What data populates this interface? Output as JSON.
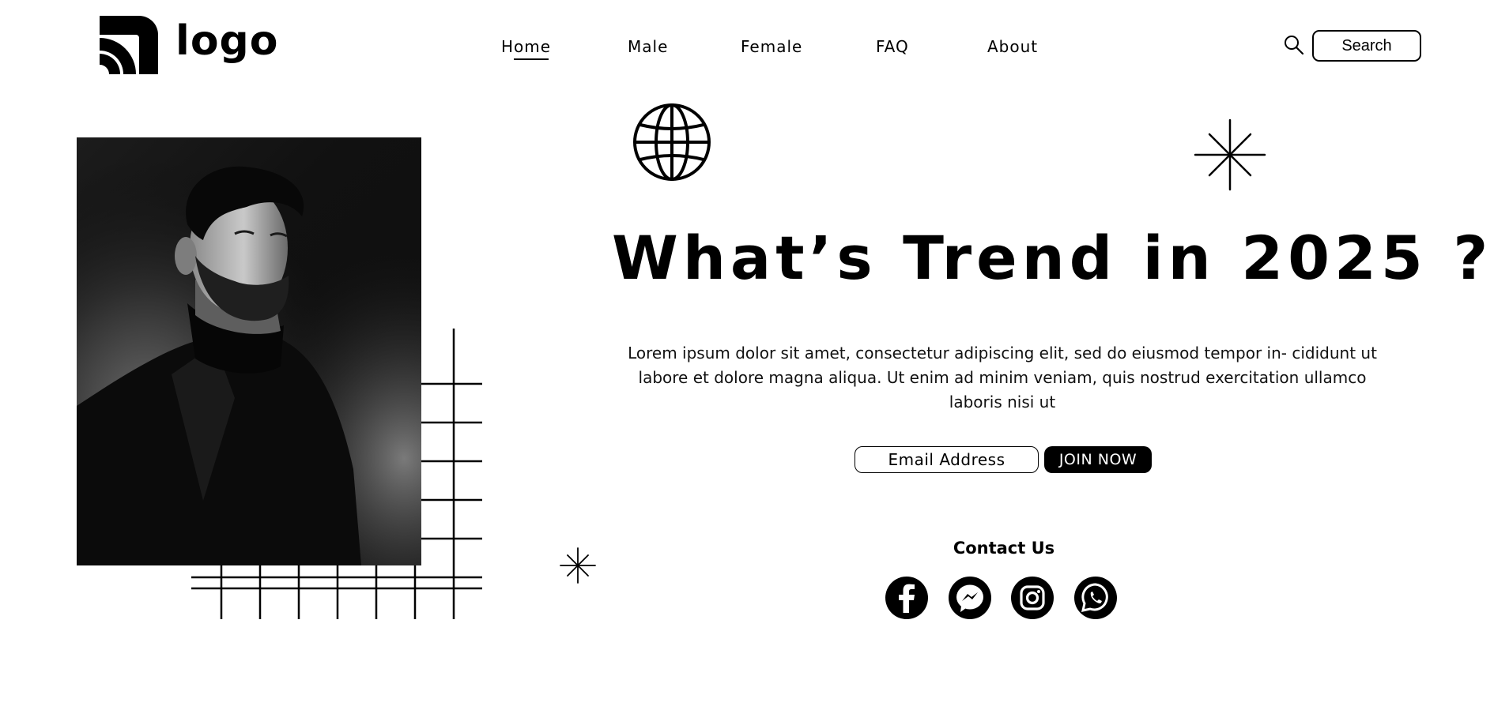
{
  "logo": {
    "text": "logo",
    "icon": "logo-arcs-icon"
  },
  "nav": {
    "items": [
      {
        "label": "Home",
        "active": true
      },
      {
        "label": "Male"
      },
      {
        "label": "Female"
      },
      {
        "label": "FAQ"
      },
      {
        "label": "About"
      }
    ]
  },
  "search": {
    "label": "Search",
    "icon": "search-icon"
  },
  "hero": {
    "headline": "What’s Trend in 2025 ?",
    "lead": "Lorem ipsum dolor sit amet, consectetur adipiscing elit, sed do eiusmod tempor in- cididunt ut labore et dolore magna aliqua. Ut enim ad minim veniam, quis nostrud exercitation ullamco laboris nisi ut",
    "email_placeholder": "Email Address",
    "join_label": "JOIN NOW"
  },
  "contact": {
    "title": "Contact Us",
    "socials": [
      "facebook-icon",
      "messenger-icon",
      "instagram-icon",
      "whatsapp-icon"
    ]
  },
  "colors": {
    "primary": "#000000",
    "background": "#ffffff"
  }
}
